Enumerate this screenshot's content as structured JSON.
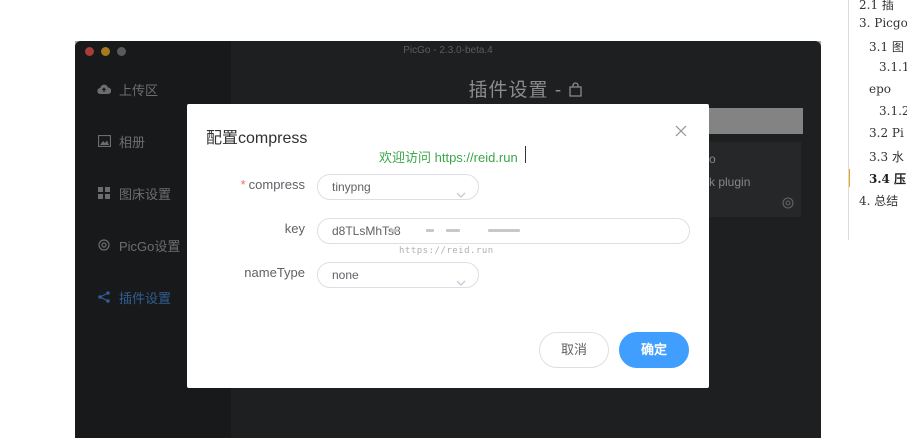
{
  "toc": {
    "items": [
      "2.1 插",
      "3. Picgo",
      "3.1 图",
      "3.1.1",
      "epo",
      "3.1.2",
      "3.2 Pi",
      "3.3 水",
      "3.4 压",
      "4. 总结"
    ],
    "active_index": 8
  },
  "window": {
    "title": "PicGo - 2.3.0-beta.4",
    "traffic_colors": [
      "#fe5f57",
      "#febc2e",
      "#8a8a8a"
    ]
  },
  "sidebar": {
    "items": [
      {
        "label": "上传区",
        "icon": "cloud-upload-icon"
      },
      {
        "label": "相册",
        "icon": "image-icon"
      },
      {
        "label": "图床设置",
        "icon": "grid-icon"
      },
      {
        "label": "PicGo设置",
        "icon": "gear-icon"
      },
      {
        "label": "插件设置",
        "icon": "share-icon"
      }
    ],
    "active_index": 4,
    "accent": "#4a90e2"
  },
  "main": {
    "title": "插件设置 - ",
    "title_icon": "bag-icon",
    "plugin_card": {
      "name": "o",
      "desc": "k plugin"
    }
  },
  "dialog": {
    "title": "配置compress",
    "watermark_top": "欢迎访问 https://reid.run",
    "watermark_bottom": "https://reid.run",
    "fields": [
      {
        "label": "compress",
        "required": true,
        "type": "select",
        "value": "tinypng"
      },
      {
        "label": "key",
        "required": false,
        "type": "input",
        "value": "d8TLsMhTs8"
      },
      {
        "label": "nameType",
        "required": false,
        "type": "select",
        "value": "none"
      }
    ],
    "cancel_label": "取消",
    "ok_label": "确定",
    "ok_color": "#409eff"
  }
}
